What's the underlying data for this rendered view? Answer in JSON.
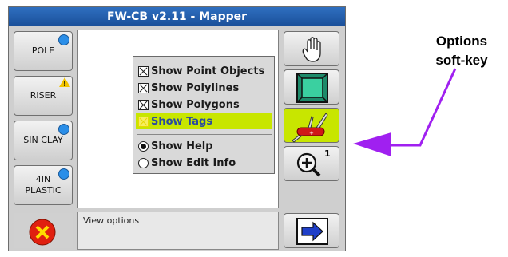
{
  "window": {
    "title": "FW-CB v2.11 - Mapper"
  },
  "left_buttons": [
    {
      "label": "POLE",
      "badge": "blue-dot"
    },
    {
      "label": "RISER",
      "badge": "warning-triangle"
    },
    {
      "label": "SIN CLAY",
      "badge": "blue-dot"
    },
    {
      "label_line1": "4IN",
      "label_line2": "PLASTIC",
      "badge": "blue-dot"
    }
  ],
  "options_menu": {
    "checkboxes": [
      {
        "label": "Show Point Objects",
        "checked": true
      },
      {
        "label": "Show Polylines",
        "checked": true
      },
      {
        "label": "Show Polygons",
        "checked": true
      },
      {
        "label": "Show Tags",
        "checked": true,
        "highlighted": true
      }
    ],
    "radios": [
      {
        "label": "Show Help",
        "selected": true
      },
      {
        "label": "Show Edit Info",
        "selected": false
      }
    ]
  },
  "right_buttons": [
    {
      "icon": "hand-icon"
    },
    {
      "icon": "frame-icon"
    },
    {
      "icon": "swiss-army-knife-icon",
      "active": true
    },
    {
      "icon": "zoom-in-icon",
      "superscript": "1"
    }
  ],
  "bottom": {
    "cancel_icon": "cancel-x-icon",
    "status_text": "View options",
    "next_icon": "next-arrow-icon"
  },
  "annotation": {
    "line1": "Options",
    "line2": "soft-key"
  },
  "colors": {
    "title_bar": "#1f5aa8",
    "highlight": "#c8e600",
    "arrow": "#a020f0",
    "badge_blue": "#2a8ee8"
  }
}
